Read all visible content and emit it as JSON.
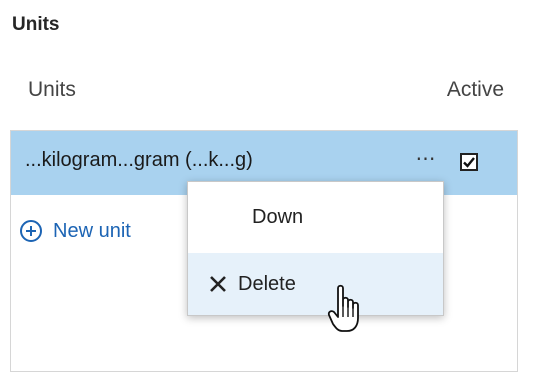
{
  "section": {
    "title": "Units"
  },
  "columns": {
    "units_header": "Units",
    "active_header": "Active"
  },
  "row": {
    "name": "...kilogram...gram (...k...g)",
    "more_label": "⋯",
    "active": true
  },
  "actions": {
    "new_unit_label": "New unit"
  },
  "context_menu": {
    "items": [
      {
        "label": "Down"
      },
      {
        "label": "Delete"
      }
    ]
  },
  "colors": {
    "row_selected": "#a9d2ef",
    "menu_hover": "#e6f1fa",
    "link": "#1c64b4"
  },
  "icons": {
    "add": "plus-circle-icon",
    "delete": "close-icon",
    "check": "checkmark-icon",
    "cursor": "hand-pointer-icon"
  }
}
